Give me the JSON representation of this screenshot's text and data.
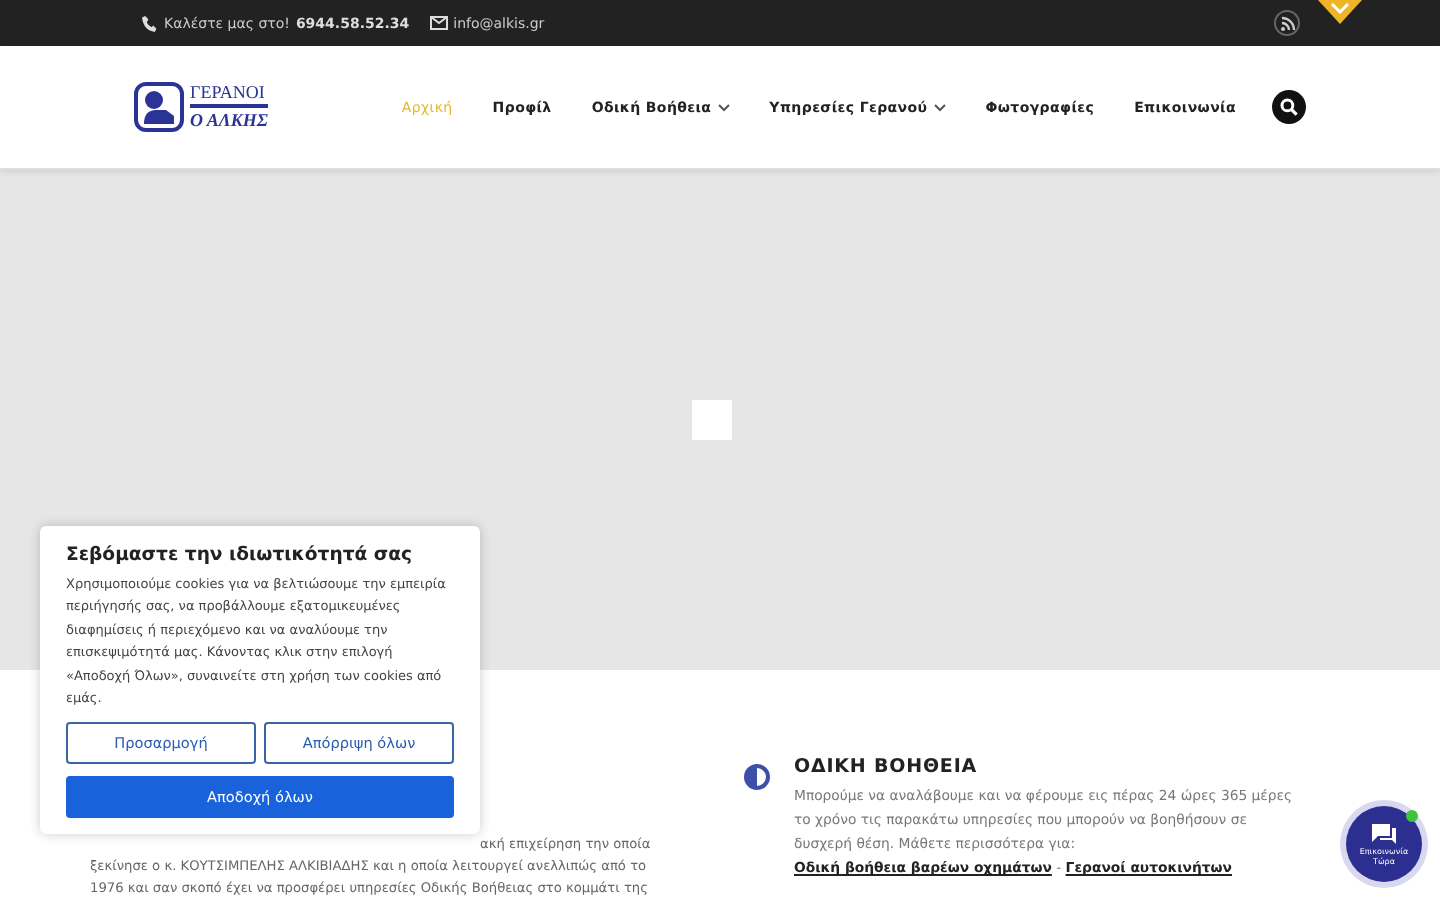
{
  "topbar": {
    "phone_label": "Καλέστε μας στο!",
    "phone": "6944.58.52.34",
    "email": "info@alkis.gr"
  },
  "logo": {
    "line1": "ΓΕΡΑΝΟΙ",
    "line2": "Ο ΑΛΚΗΣ"
  },
  "nav": [
    {
      "label": "Αρχική",
      "selected": true,
      "dropdown": false
    },
    {
      "label": "Προφίλ",
      "selected": false,
      "dropdown": false
    },
    {
      "label": "Οδική Βοήθεια",
      "selected": false,
      "dropdown": true
    },
    {
      "label": "Υπηρεσίες Γερανού",
      "selected": false,
      "dropdown": true
    },
    {
      "label": "Φωτογραφίες",
      "selected": false,
      "dropdown": false
    },
    {
      "label": "Επικοινωνία",
      "selected": false,
      "dropdown": false
    }
  ],
  "intro_lines": [
    "ακή επιχείρηση την οποία",
    "ξεκίνησε ο κ. ΚΟΥΤΣΙΜΠΕΛΗΣ ΑΛΚΙΒΙΑΔΗΣ και η οποία λειτουργεί ανελλιπώς από το",
    "1976 και σαν σκοπό έχει να προσφέρει υπηρεσίες Οδικής Βοήθειας στο κομμάτι της"
  ],
  "feature": {
    "title": "ΟΔΙΚΗ ΒΟΗΘΕΙΑ",
    "text": "Μπορούμε να αναλάβουμε και να φέρουμε εις πέρας 24 ώρες 365 μέρες το χρόνο τις παρακάτω υπηρεσίες που μπορούν να βοηθήσουν σε δυσχερή θέση. Μάθετε περισσότερα για:",
    "link1": "Οδική βοήθεια βαρέων οχημάτων",
    "separator": "-",
    "link2": "Γερανοί αυτοκινήτων"
  },
  "cookie": {
    "title": "Σεβόμαστε την ιδιωτικότητά σας",
    "text": "Χρησιμοποιούμε cookies για να βελτιώσουμε την εμπειρία περιήγησής σας, να προβάλλουμε εξατομικευμένες διαφημίσεις ή περιεχόμενο και να αναλύουμε την επισκεψιμότητά μας. Κάνοντας κλικ στην επιλογή «Αποδοχή Όλων», συναινείτε στη χρήση των cookies από εμάς.",
    "buttons": [
      {
        "label": "Προσαρμογή",
        "kind": "outline"
      },
      {
        "label": "Απόρριψη όλων",
        "kind": "outline"
      },
      {
        "label": "Αποδοχή όλων",
        "kind": "primary"
      }
    ]
  },
  "chat": {
    "label": "Επικοινωνία Τώρα",
    "online": true
  }
}
